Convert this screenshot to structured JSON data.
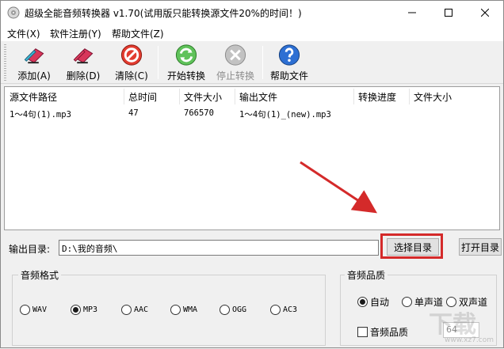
{
  "window": {
    "title": "超级全能音频转换器 v1.70(试用版只能转换源文件20%的时间！)"
  },
  "menu": [
    "文件(X)",
    "软件注册(Y)",
    "帮助文件(Z)"
  ],
  "toolbar": {
    "add": "添加(A)",
    "delete": "删除(D)",
    "clear": "清除(C)",
    "start": "开始转换",
    "stop": "停止转换",
    "help": "帮助文件"
  },
  "table": {
    "columns": [
      "源文件路径",
      "总时间",
      "文件大小",
      "输出文件",
      "转换进度",
      "文件大小"
    ],
    "rows": [
      [
        "1～4句(1).mp3",
        "47",
        "766570",
        "1～4句(1)_(new).mp3",
        "",
        ""
      ]
    ]
  },
  "output": {
    "label": "输出目录:",
    "path": "D:\\我的音频\\",
    "choose_label": "选择目录",
    "open_label": "打开目录"
  },
  "format": {
    "title": "音频格式",
    "options": [
      "WAV",
      "MP3",
      "AAC",
      "WMA",
      "OGG",
      "AC3"
    ],
    "selected": "MP3"
  },
  "quality": {
    "title": "音频品质",
    "channels": [
      "自动",
      "单声道",
      "双声道"
    ],
    "selected": "自动",
    "checkbox_label": "音频品质",
    "checkbox_checked": false,
    "value": "64"
  },
  "watermark": {
    "text": "下载",
    "sub": "www.xz7.com"
  },
  "colors": {
    "highlight": "#d42a2a"
  }
}
